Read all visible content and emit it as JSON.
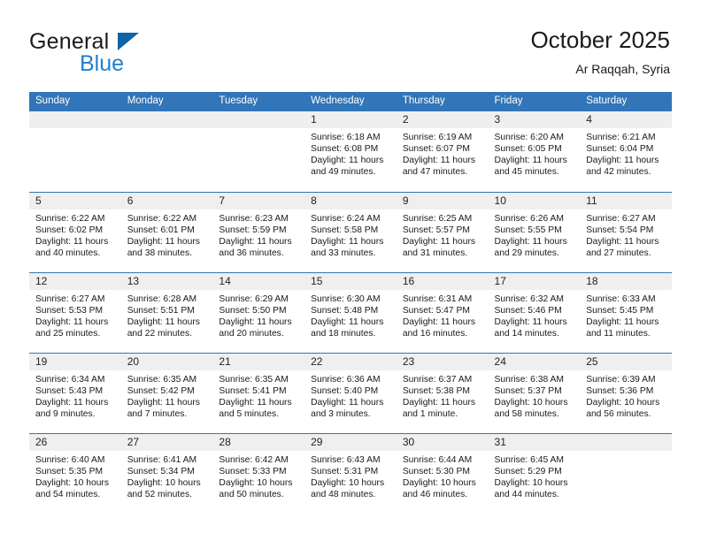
{
  "brand": {
    "word1": "General",
    "word2": "Blue",
    "triangle_color": "#1063A6",
    "blue_text_color": "#1F7FD0"
  },
  "header": {
    "title": "October 2025",
    "subtitle": "Ar Raqqah, Syria"
  },
  "theme": {
    "header_blue": "#3275B8",
    "daynum_band": "#EFEFEF",
    "text": "#1A1A1A"
  },
  "calendar": {
    "weekday_headers": [
      "Sunday",
      "Monday",
      "Tuesday",
      "Wednesday",
      "Thursday",
      "Friday",
      "Saturday"
    ],
    "weeks": [
      [
        {
          "day": "",
          "lines": []
        },
        {
          "day": "",
          "lines": []
        },
        {
          "day": "",
          "lines": []
        },
        {
          "day": "1",
          "lines": [
            "Sunrise: 6:18 AM",
            "Sunset: 6:08 PM",
            "Daylight: 11 hours",
            "and 49 minutes."
          ]
        },
        {
          "day": "2",
          "lines": [
            "Sunrise: 6:19 AM",
            "Sunset: 6:07 PM",
            "Daylight: 11 hours",
            "and 47 minutes."
          ]
        },
        {
          "day": "3",
          "lines": [
            "Sunrise: 6:20 AM",
            "Sunset: 6:05 PM",
            "Daylight: 11 hours",
            "and 45 minutes."
          ]
        },
        {
          "day": "4",
          "lines": [
            "Sunrise: 6:21 AM",
            "Sunset: 6:04 PM",
            "Daylight: 11 hours",
            "and 42 minutes."
          ]
        }
      ],
      [
        {
          "day": "5",
          "lines": [
            "Sunrise: 6:22 AM",
            "Sunset: 6:02 PM",
            "Daylight: 11 hours",
            "and 40 minutes."
          ]
        },
        {
          "day": "6",
          "lines": [
            "Sunrise: 6:22 AM",
            "Sunset: 6:01 PM",
            "Daylight: 11 hours",
            "and 38 minutes."
          ]
        },
        {
          "day": "7",
          "lines": [
            "Sunrise: 6:23 AM",
            "Sunset: 5:59 PM",
            "Daylight: 11 hours",
            "and 36 minutes."
          ]
        },
        {
          "day": "8",
          "lines": [
            "Sunrise: 6:24 AM",
            "Sunset: 5:58 PM",
            "Daylight: 11 hours",
            "and 33 minutes."
          ]
        },
        {
          "day": "9",
          "lines": [
            "Sunrise: 6:25 AM",
            "Sunset: 5:57 PM",
            "Daylight: 11 hours",
            "and 31 minutes."
          ]
        },
        {
          "day": "10",
          "lines": [
            "Sunrise: 6:26 AM",
            "Sunset: 5:55 PM",
            "Daylight: 11 hours",
            "and 29 minutes."
          ]
        },
        {
          "day": "11",
          "lines": [
            "Sunrise: 6:27 AM",
            "Sunset: 5:54 PM",
            "Daylight: 11 hours",
            "and 27 minutes."
          ]
        }
      ],
      [
        {
          "day": "12",
          "lines": [
            "Sunrise: 6:27 AM",
            "Sunset: 5:53 PM",
            "Daylight: 11 hours",
            "and 25 minutes."
          ]
        },
        {
          "day": "13",
          "lines": [
            "Sunrise: 6:28 AM",
            "Sunset: 5:51 PM",
            "Daylight: 11 hours",
            "and 22 minutes."
          ]
        },
        {
          "day": "14",
          "lines": [
            "Sunrise: 6:29 AM",
            "Sunset: 5:50 PM",
            "Daylight: 11 hours",
            "and 20 minutes."
          ]
        },
        {
          "day": "15",
          "lines": [
            "Sunrise: 6:30 AM",
            "Sunset: 5:48 PM",
            "Daylight: 11 hours",
            "and 18 minutes."
          ]
        },
        {
          "day": "16",
          "lines": [
            "Sunrise: 6:31 AM",
            "Sunset: 5:47 PM",
            "Daylight: 11 hours",
            "and 16 minutes."
          ]
        },
        {
          "day": "17",
          "lines": [
            "Sunrise: 6:32 AM",
            "Sunset: 5:46 PM",
            "Daylight: 11 hours",
            "and 14 minutes."
          ]
        },
        {
          "day": "18",
          "lines": [
            "Sunrise: 6:33 AM",
            "Sunset: 5:45 PM",
            "Daylight: 11 hours",
            "and 11 minutes."
          ]
        }
      ],
      [
        {
          "day": "19",
          "lines": [
            "Sunrise: 6:34 AM",
            "Sunset: 5:43 PM",
            "Daylight: 11 hours",
            "and 9 minutes."
          ]
        },
        {
          "day": "20",
          "lines": [
            "Sunrise: 6:35 AM",
            "Sunset: 5:42 PM",
            "Daylight: 11 hours",
            "and 7 minutes."
          ]
        },
        {
          "day": "21",
          "lines": [
            "Sunrise: 6:35 AM",
            "Sunset: 5:41 PM",
            "Daylight: 11 hours",
            "and 5 minutes."
          ]
        },
        {
          "day": "22",
          "lines": [
            "Sunrise: 6:36 AM",
            "Sunset: 5:40 PM",
            "Daylight: 11 hours",
            "and 3 minutes."
          ]
        },
        {
          "day": "23",
          "lines": [
            "Sunrise: 6:37 AM",
            "Sunset: 5:38 PM",
            "Daylight: 11 hours",
            "and 1 minute."
          ]
        },
        {
          "day": "24",
          "lines": [
            "Sunrise: 6:38 AM",
            "Sunset: 5:37 PM",
            "Daylight: 10 hours",
            "and 58 minutes."
          ]
        },
        {
          "day": "25",
          "lines": [
            "Sunrise: 6:39 AM",
            "Sunset: 5:36 PM",
            "Daylight: 10 hours",
            "and 56 minutes."
          ]
        }
      ],
      [
        {
          "day": "26",
          "lines": [
            "Sunrise: 6:40 AM",
            "Sunset: 5:35 PM",
            "Daylight: 10 hours",
            "and 54 minutes."
          ]
        },
        {
          "day": "27",
          "lines": [
            "Sunrise: 6:41 AM",
            "Sunset: 5:34 PM",
            "Daylight: 10 hours",
            "and 52 minutes."
          ]
        },
        {
          "day": "28",
          "lines": [
            "Sunrise: 6:42 AM",
            "Sunset: 5:33 PM",
            "Daylight: 10 hours",
            "and 50 minutes."
          ]
        },
        {
          "day": "29",
          "lines": [
            "Sunrise: 6:43 AM",
            "Sunset: 5:31 PM",
            "Daylight: 10 hours",
            "and 48 minutes."
          ]
        },
        {
          "day": "30",
          "lines": [
            "Sunrise: 6:44 AM",
            "Sunset: 5:30 PM",
            "Daylight: 10 hours",
            "and 46 minutes."
          ]
        },
        {
          "day": "31",
          "lines": [
            "Sunrise: 6:45 AM",
            "Sunset: 5:29 PM",
            "Daylight: 10 hours",
            "and 44 minutes."
          ]
        },
        {
          "day": "",
          "lines": []
        }
      ]
    ]
  }
}
